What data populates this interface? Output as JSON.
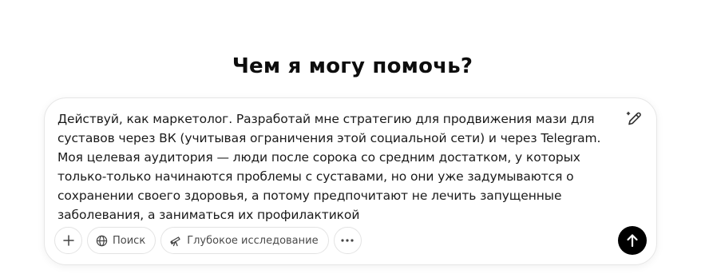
{
  "heading": "Чем я могу помочь?",
  "composer": {
    "prompt_value": "Действуй, как маркетолог. Разработай мне стратегию для продвижения мази для суставов через ВК (учитывая ограничения этой социальной сети) и через Telegram. Моя целевая аудитория — люди после сорока со средним достатком, у которых только-только начинаются проблемы с суставами, но они уже задумываются о сохранении своего здоровья, а потому предпочитают не лечить запущенные заболевания, а заниматься их профилактикой"
  },
  "toolbar": {
    "add_icon": "plus-icon",
    "search_label": "Поиск",
    "search_icon": "globe-icon",
    "research_label": "Глубокое исследование",
    "research_icon": "telescope-icon",
    "more_icon": "more-dots-icon",
    "send_icon": "arrow-up-icon",
    "edit_icon": "pen-sparkle-icon"
  },
  "colors": {
    "send_bg": "#000000",
    "border": "#e3e3e3",
    "text": "#0d0d0d"
  }
}
